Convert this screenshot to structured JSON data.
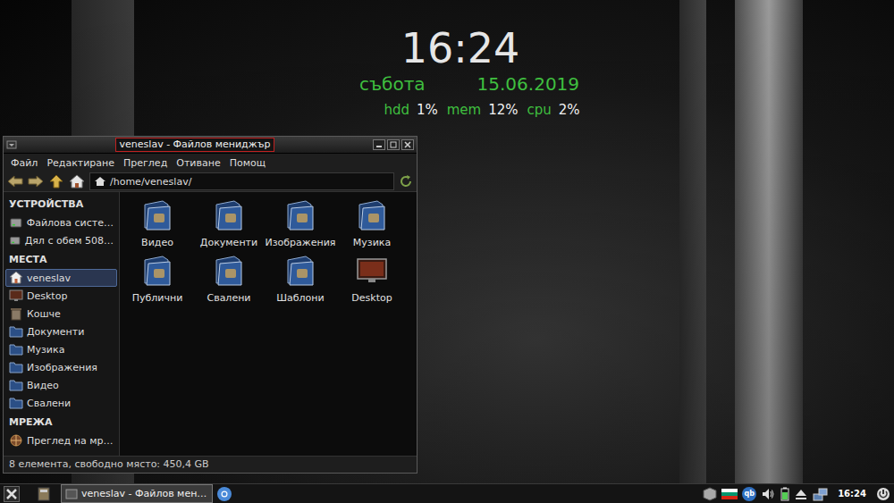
{
  "desktop": {
    "conky": {
      "time": "16:24",
      "day": "събота",
      "date": "15.06.2019",
      "stats": [
        {
          "label": "hdd",
          "value": "1%"
        },
        {
          "label": "mem",
          "value": "12%"
        },
        {
          "label": "cpu",
          "value": "2%"
        }
      ]
    }
  },
  "window": {
    "title": "veneslav - Файлов мениджър",
    "active": true
  },
  "menu": [
    "Файл",
    "Редактиране",
    "Преглед",
    "Отиване",
    "Помощ"
  ],
  "toolbar": {
    "path": "/home/veneslav/"
  },
  "sidebar": {
    "sections": [
      {
        "title": "УСТРОЙСТВА",
        "items": [
          {
            "label": "Файлова систе…",
            "kind": "drive",
            "selected": false
          },
          {
            "label": "Дял с обем 508…",
            "kind": "drive",
            "selected": false
          }
        ]
      },
      {
        "title": "МЕСТА",
        "items": [
          {
            "label": "veneslav",
            "kind": "home",
            "selected": true
          },
          {
            "label": "Desktop",
            "kind": "desktop",
            "selected": false
          },
          {
            "label": "Кошче",
            "kind": "trash",
            "selected": false
          },
          {
            "label": "Документи",
            "kind": "folder",
            "selected": false
          },
          {
            "label": "Музика",
            "kind": "folder",
            "selected": false
          },
          {
            "label": "Изображения",
            "kind": "folder",
            "selected": false
          },
          {
            "label": "Видео",
            "kind": "folder",
            "selected": false
          },
          {
            "label": "Свалени",
            "kind": "folder",
            "selected": false
          }
        ]
      },
      {
        "title": "МРЕЖА",
        "items": [
          {
            "label": "Преглед на мр…",
            "kind": "network",
            "selected": false
          }
        ]
      }
    ]
  },
  "files": [
    {
      "name": "Видео",
      "kind": "folder",
      "selected": false
    },
    {
      "name": "Документи",
      "kind": "folder",
      "selected": false
    },
    {
      "name": "Изображения",
      "kind": "folder",
      "selected": false
    },
    {
      "name": "Музика",
      "kind": "folder",
      "selected": false
    },
    {
      "name": "Публични",
      "kind": "folder",
      "selected": false
    },
    {
      "name": "Свалени",
      "kind": "folder",
      "selected": false
    },
    {
      "name": "Шаблони",
      "kind": "folder",
      "selected": false
    },
    {
      "name": "Desktop",
      "kind": "desktop",
      "selected": false
    }
  ],
  "status_bar": "8 елемента, свободно място: 450,4 GB",
  "taskbar": {
    "tasks": [
      {
        "label": "veneslav - Файлов мен…",
        "selected": true
      }
    ],
    "tray_badge": "qb",
    "clock": "16:24"
  }
}
